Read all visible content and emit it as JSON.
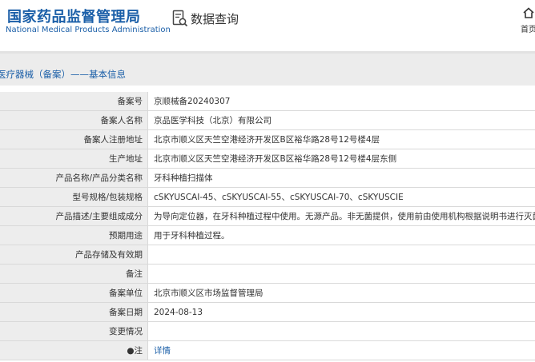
{
  "header": {
    "logo_cn": "国家药品监督管理局",
    "logo_en": "National Medical Products Administration",
    "search_label": "数据查询",
    "home_label": "首页"
  },
  "breadcrumb": "医疗器械（备案）——基本信息",
  "rows": [
    {
      "label": "备案号",
      "value": "京顺械备20240307"
    },
    {
      "label": "备案人名称",
      "value": "京品医学科技（北京）有限公司"
    },
    {
      "label": "备案人注册地址",
      "value": "北京市顺义区天竺空港经济开发区B区裕华路28号12号楼4层"
    },
    {
      "label": "生产地址",
      "value": "北京市顺义区天竺空港经济开发区B区裕华路28号12号楼4层东侧"
    },
    {
      "label": "产品名称/产品分类名称",
      "value": "牙科种植扫描体"
    },
    {
      "label": "型号规格/包装规格",
      "value": "cSKYUSCAI-45、cSKYUSCAI-55、cSKYUSCAI-70、cSKYUSCIE"
    },
    {
      "label": "产品描述/主要组成成分",
      "value": "为导向定位器，在牙科种植过程中使用。无源产品。非无菌提供，使用前由使用机构根据说明书进行灭菌。"
    },
    {
      "label": "预期用途",
      "value": "用于牙科种植过程。"
    },
    {
      "label": "产品存储及有效期",
      "value": ""
    },
    {
      "label": "备注",
      "value": ""
    },
    {
      "label": "备案单位",
      "value": "北京市顺义区市场监督管理局"
    },
    {
      "label": "备案日期",
      "value": "2024-08-13"
    },
    {
      "label": "变更情况",
      "value": ""
    },
    {
      "label": "●注",
      "value": "详情",
      "link": true
    }
  ]
}
